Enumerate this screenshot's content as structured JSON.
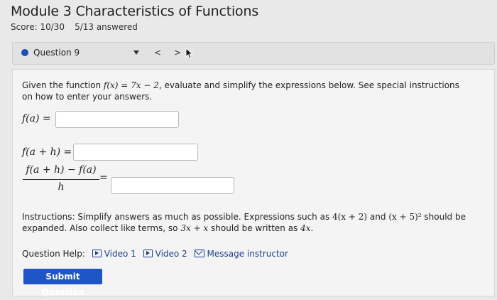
{
  "header": {
    "title": "Module 3 Characteristics of Functions",
    "score": "Score: 10/30",
    "answered": "5/13 answered"
  },
  "question_nav": {
    "selected": "Question 9",
    "prev_label": "<",
    "next_label": ">",
    "accent": "#1a4fb3"
  },
  "problem": {
    "prompt_pre": "Given the function ",
    "function_def": "f(x) = 7x − 2",
    "prompt_post": ", evaluate and simplify the expressions below. See special instructions on how to enter your answers.",
    "expr1": "f(a) =",
    "expr2": "f(a + h) =",
    "frac_num": "f(a + h) − f(a)",
    "frac_den": "h",
    "frac_eq": "="
  },
  "instructions": {
    "text_a": "Instructions: Simplify answers as much as possible. Expressions such as ",
    "ex1": "4(x + 2)",
    "text_b": " and ",
    "ex2": "(x + 5)²",
    "text_c": " should be expanded. Also collect like terms, so ",
    "ex3": "3x + x",
    "text_d": " should be written as ",
    "ex4": "4x",
    "text_e": "."
  },
  "help": {
    "label": "Question Help:",
    "video1": "Video 1",
    "video2": "Video 2",
    "message": "Message instructor"
  },
  "submit_label": "Submit Question"
}
